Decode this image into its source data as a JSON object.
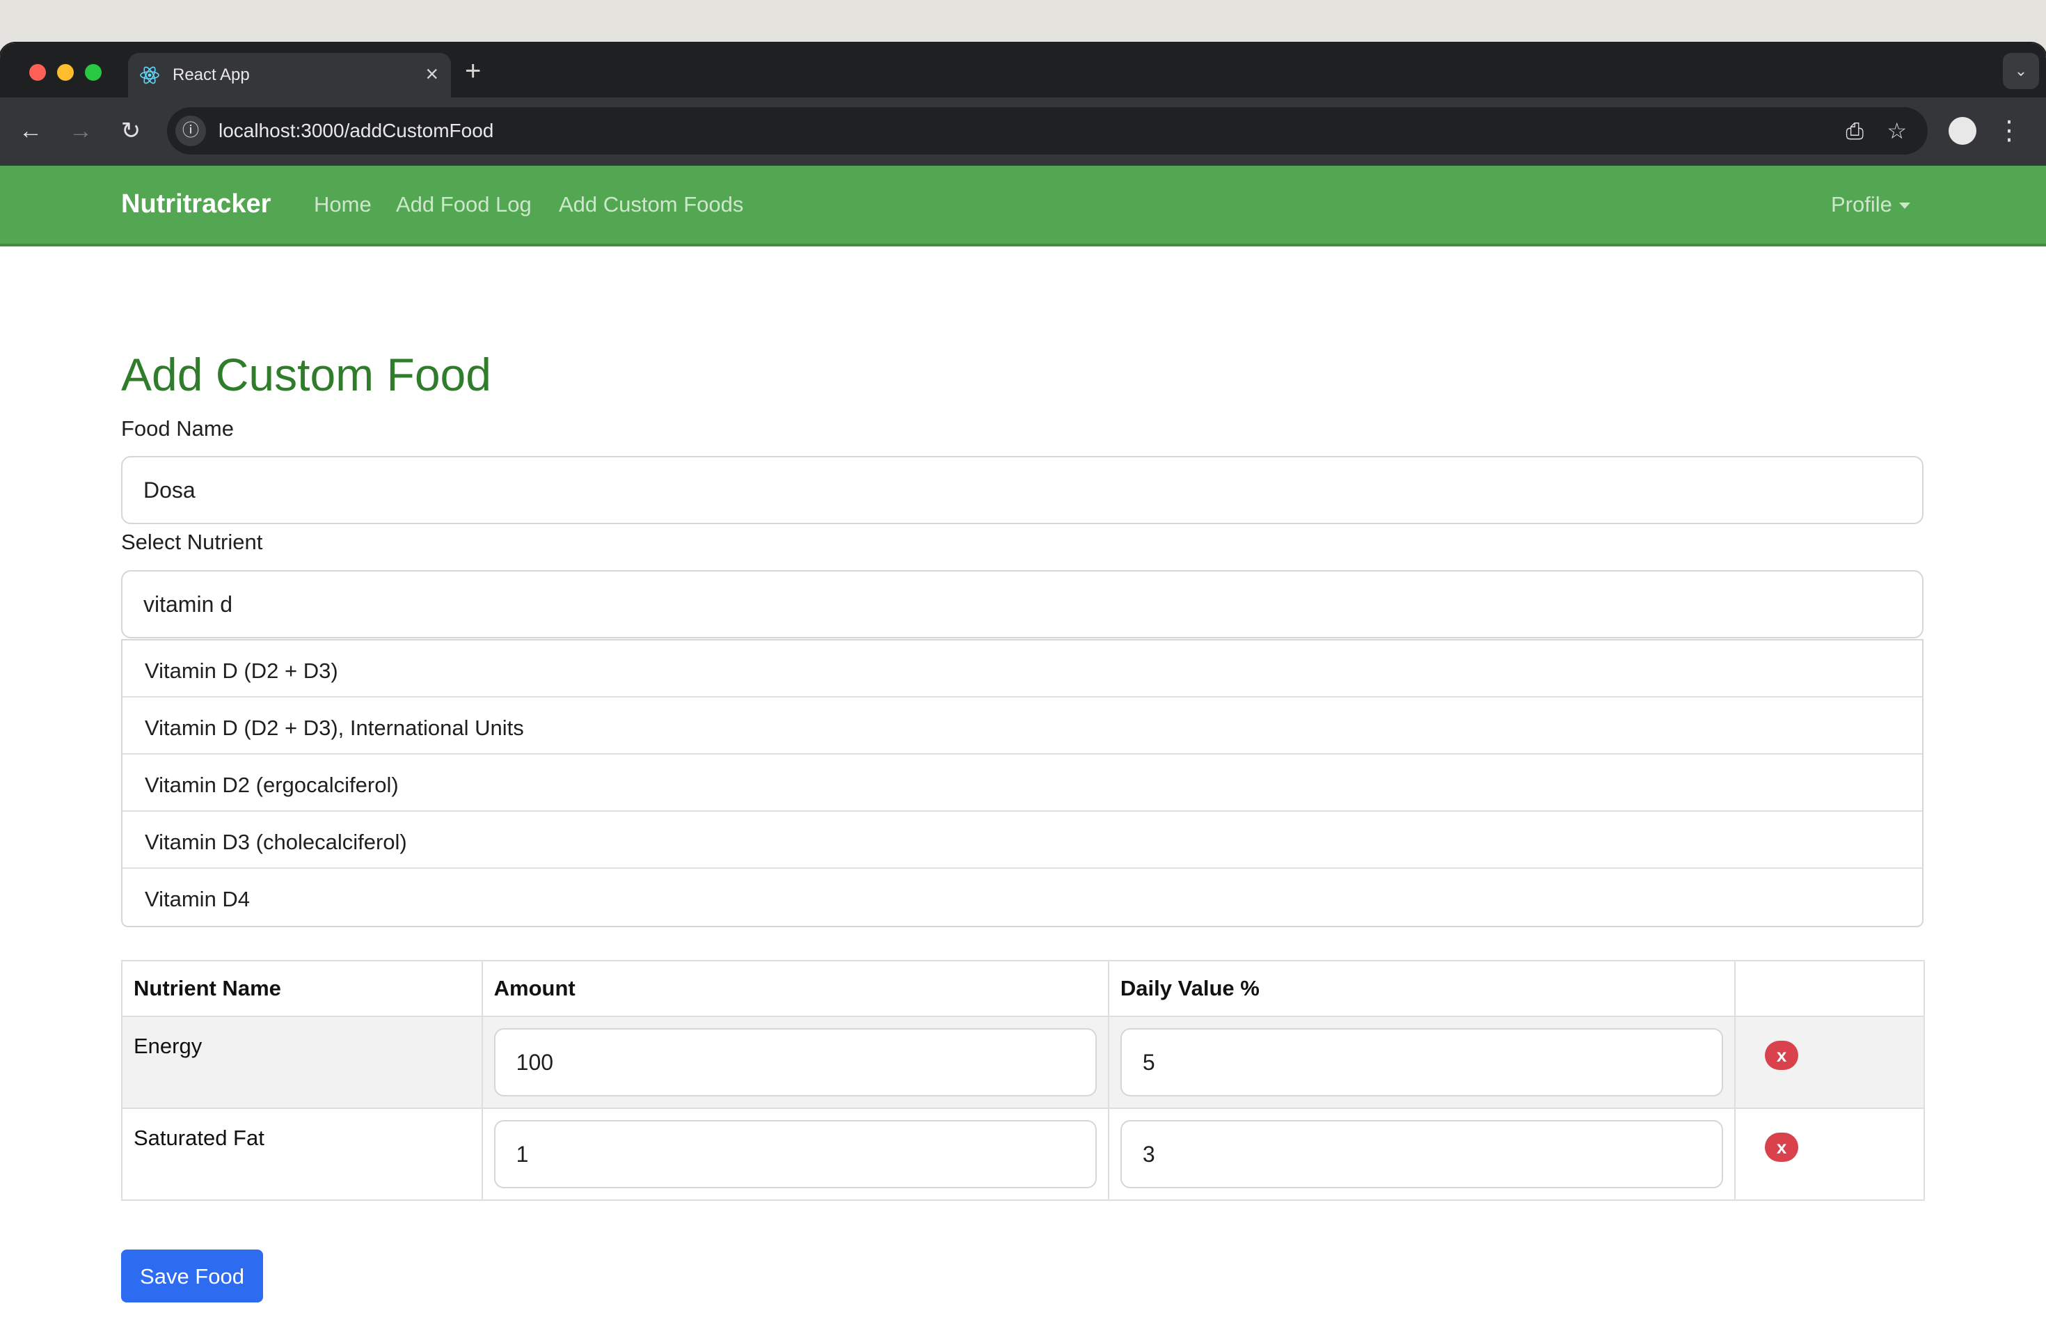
{
  "browser": {
    "tab_title": "React App",
    "tab_close": "×",
    "new_tab": "+",
    "tab_menu": "⌄",
    "url": "localhost:3000/addCustomFood",
    "icons": [
      "close-icon",
      "plus-icon",
      "back-icon",
      "forward-icon",
      "reload-icon",
      "info-icon",
      "install-icon",
      "star-icon",
      "profile-icon",
      "kebab-icon"
    ]
  },
  "navbar": {
    "brand": "Nutritracker",
    "links": [
      "Home",
      "Add Food Log",
      "Add Custom Foods"
    ],
    "profile": "Profile",
    "color": "#54a752"
  },
  "page": {
    "title": "Add Custom Food",
    "food_name_label": "Food Name",
    "food_name_value": "Dosa",
    "nutrient_label": "Select Nutrient",
    "nutrient_value": "vitamin d",
    "suggestions": [
      "Vitamin D (D2 + D3)",
      "Vitamin D (D2 + D3), International Units",
      "Vitamin D2 (ergocalciferol)",
      "Vitamin D3 (cholecalciferol)",
      "Vitamin D4"
    ]
  },
  "table": {
    "headers": [
      "Nutrient Name",
      "Amount",
      "Daily Value %",
      ""
    ],
    "rows": [
      {
        "name": "Energy",
        "amount": "100",
        "daily_value": "5",
        "remove": "x"
      },
      {
        "name": "Saturated Fat",
        "amount": "1",
        "daily_value": "3",
        "remove": "x"
      }
    ]
  },
  "save_button": "Save Food",
  "colors": {
    "accent": "#2d6cf0",
    "danger": "#d9414c",
    "title": "#2f7d2a"
  }
}
